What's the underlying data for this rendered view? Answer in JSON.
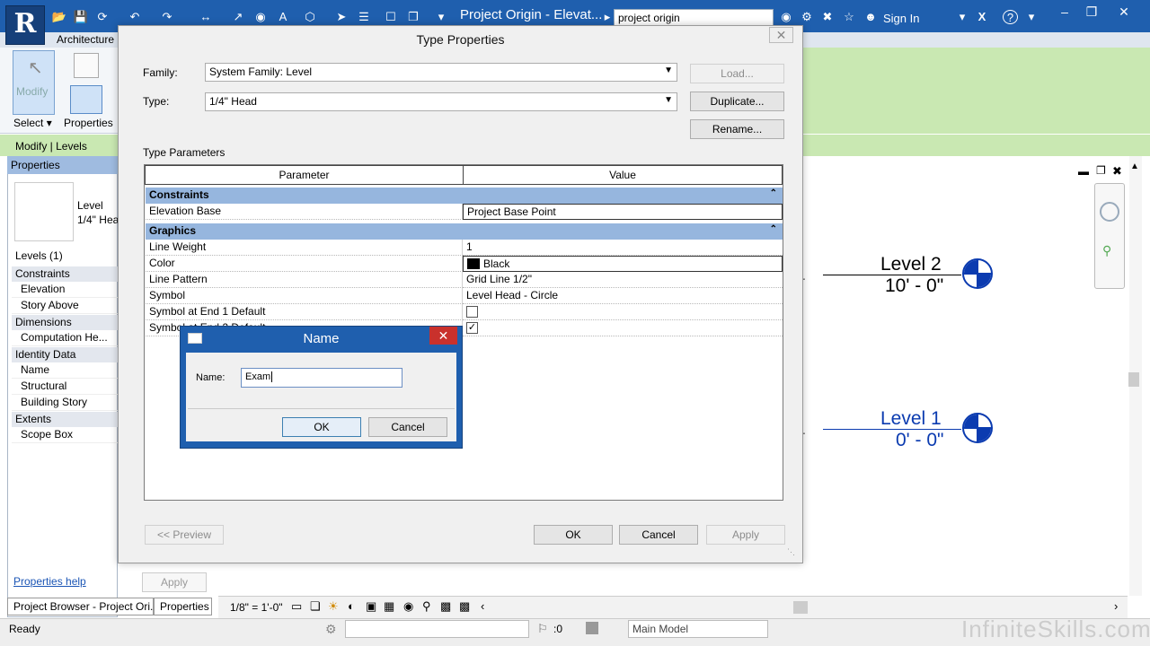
{
  "app": {
    "logo_letter": "R",
    "window_title": "Project Origin - Elevat...",
    "search_value": "project origin",
    "sign_in": "Sign In",
    "help": "?",
    "minimize": "–",
    "restore": "❐",
    "close": "✕"
  },
  "ribbon": {
    "tab": "Architecture",
    "modify_label": "Modify",
    "select_label": "Select",
    "properties_label": "Properties",
    "context_label": "Modify | Levels"
  },
  "properties_palette": {
    "title": "Properties",
    "type_line1": "Level",
    "type_line2": "1/4\" Hea",
    "instance_filter": "Levels (1)",
    "sections": [
      {
        "label": "Constraints",
        "rows": [
          "Elevation",
          "Story Above"
        ]
      },
      {
        "label": "Dimensions",
        "rows": [
          "Computation He..."
        ]
      },
      {
        "label": "Identity Data",
        "rows": [
          "Name",
          "Structural",
          "Building Story"
        ]
      },
      {
        "label": "Extents",
        "rows": [
          "Scope Box"
        ]
      }
    ],
    "help_link": "Properties help",
    "apply": "Apply"
  },
  "bottom_tabs": {
    "project_browser": "Project Browser - Project Ori...",
    "properties": "Properties"
  },
  "view_control": {
    "scale": "1/8\" = 1'-0\""
  },
  "status_bar": {
    "text": "Ready",
    "count": ":0",
    "model": "Main Model",
    "watermark": "InfiniteSkills.com"
  },
  "canvas": {
    "level2_name": "Level 2",
    "level2_elev": "10' - 0\"",
    "level1_name": "Level 1",
    "level1_elev": "0' - 0\""
  },
  "type_properties": {
    "title": "Type Properties",
    "family_label": "Family:",
    "family_value": "System Family: Level",
    "type_label": "Type:",
    "type_value": "1/4\" Head",
    "load_button": "Load...",
    "duplicate_button": "Duplicate...",
    "rename_button": "Rename...",
    "section_label": "Type Parameters",
    "col_parameter": "Parameter",
    "col_value": "Value",
    "groups": [
      {
        "label": "Constraints",
        "rows": [
          {
            "param": "Elevation Base",
            "value": "Project Base Point"
          }
        ]
      },
      {
        "label": "Graphics",
        "rows": [
          {
            "param": "Line Weight",
            "value": "1"
          },
          {
            "param": "Color",
            "value": "Black"
          },
          {
            "param": "Line Pattern",
            "value": "Grid Line 1/2\""
          },
          {
            "param": "Symbol",
            "value": "Level Head - Circle"
          },
          {
            "param": "Symbol at End 1 Default",
            "value": ""
          },
          {
            "param": "Symbol at End 2 Default",
            "value": "✓"
          }
        ]
      }
    ],
    "preview_button": "<< Preview",
    "ok_button": "OK",
    "cancel_button": "Cancel",
    "apply_button": "Apply",
    "collapse_icon": "⌃"
  },
  "name_dialog": {
    "title": "Name",
    "label": "Name:",
    "value": "Exam",
    "ok": "OK",
    "cancel": "Cancel",
    "close": "✕"
  }
}
